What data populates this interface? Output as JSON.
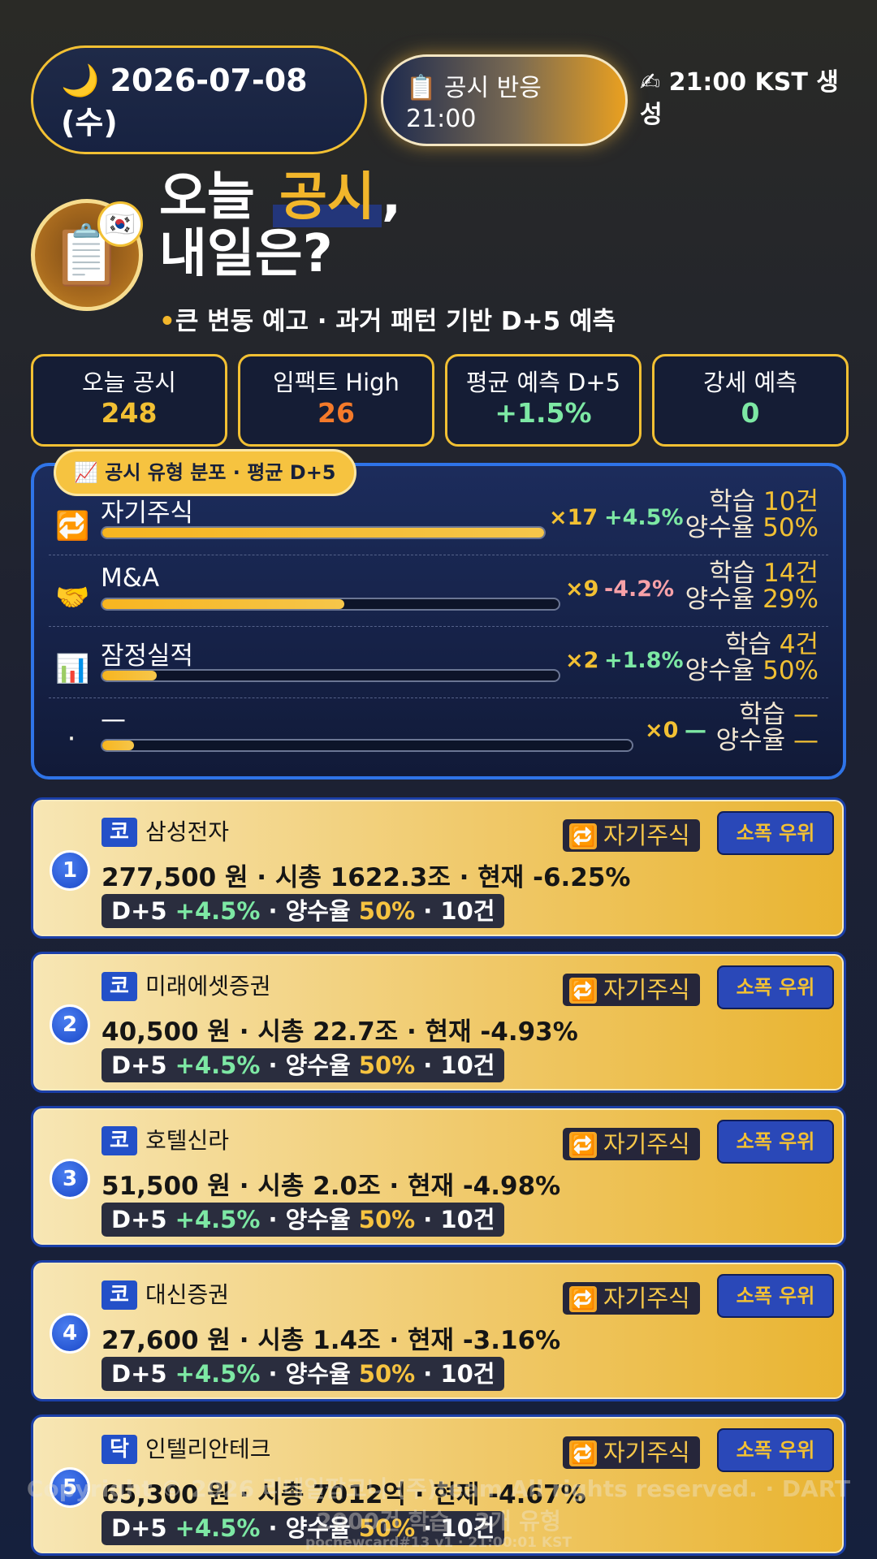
{
  "header": {
    "date": "🌙 2026-07-08 (수)",
    "event_line1": "📋 공시 반응",
    "event_line2": "21:00",
    "generated": "✍ 21:00 KST 생성"
  },
  "hero": {
    "icon": "📋",
    "flag": "🇰🇷",
    "title_a": "오늘 ",
    "title_highlight": "공시",
    "title_b": ",",
    "title_line2": "내일은?",
    "subtitle": "큰 변동 예고 · 과거 패턴 기반 D+5 예측"
  },
  "stats": [
    {
      "label": "오늘 공시",
      "value": "248",
      "color": "#f2c033"
    },
    {
      "label": "임팩트 High",
      "value": "26",
      "color": "#f47a2a"
    },
    {
      "label": "평균 예측 D+5",
      "value": "+1.5%",
      "color": "#7de8a4"
    },
    {
      "label": "강세 예측",
      "value": "0",
      "color": "#7de8a4"
    }
  ],
  "distribution": {
    "tag": "📈 공시 유형 분포 · 평균 D+5",
    "rows": [
      {
        "icon": "🔁",
        "name": "자기주식",
        "count": "×17",
        "pct": "+4.5%",
        "pct_color": "#7de8a4",
        "learn_label": "학습",
        "learn": "10건",
        "win_label": "양수율",
        "win": "50%",
        "fill": 1.0
      },
      {
        "icon": "🤝",
        "name": "M&A",
        "count": "×9",
        "pct": "-4.2%",
        "pct_color": "#f8a1a8",
        "learn_label": "학습",
        "learn": "14건",
        "win_label": "양수율",
        "win": "29%",
        "fill": 0.53
      },
      {
        "icon": "📊",
        "name": "잠정실적",
        "count": "×2",
        "pct": "+1.8%",
        "pct_color": "#7de8a4",
        "learn_label": "학습",
        "learn": "4건",
        "win_label": "양수율",
        "win": "50%",
        "fill": 0.12
      },
      {
        "icon": "·",
        "name": "—",
        "count": "×0",
        "pct": "—",
        "pct_color": "#7de8a4",
        "learn_label": "학습",
        "learn": "—",
        "win_label": "양수율",
        "win": "—",
        "fill": 0.06
      }
    ]
  },
  "stocks": [
    {
      "rank": "1",
      "market": "코",
      "name": "삼성전자",
      "type": "자기주식",
      "type_icon": "🔁",
      "priority": "소폭 우위",
      "price": "277,500 원",
      "cap": "시총 1622.3조",
      "change": "현재 -6.25%",
      "d5_label": "D+5",
      "d5": "+4.5%",
      "win_label": "양수율",
      "win": "50%",
      "samples": "10건"
    },
    {
      "rank": "2",
      "market": "코",
      "name": "미래에셋증권",
      "type": "자기주식",
      "type_icon": "🔁",
      "priority": "소폭 우위",
      "price": "40,500 원",
      "cap": "시총 22.7조",
      "change": "현재 -4.93%",
      "d5_label": "D+5",
      "d5": "+4.5%",
      "win_label": "양수율",
      "win": "50%",
      "samples": "10건"
    },
    {
      "rank": "3",
      "market": "코",
      "name": "호텔신라",
      "type": "자기주식",
      "type_icon": "🔁",
      "priority": "소폭 우위",
      "price": "51,500 원",
      "cap": "시총 2.0조",
      "change": "현재 -4.98%",
      "d5_label": "D+5",
      "d5": "+4.5%",
      "win_label": "양수율",
      "win": "50%",
      "samples": "10건"
    },
    {
      "rank": "4",
      "market": "코",
      "name": "대신증권",
      "type": "자기주식",
      "type_icon": "🔁",
      "priority": "소폭 우위",
      "price": "27,600 원",
      "cap": "시총 1.4조",
      "change": "현재 -3.16%",
      "d5_label": "D+5",
      "d5": "+4.5%",
      "win_label": "양수율",
      "win": "50%",
      "samples": "10건"
    },
    {
      "rank": "5",
      "market": "닥",
      "name": "인텔리안테크",
      "type": "자기주식",
      "type_icon": "🔁",
      "priority": "소폭 우위",
      "price": "65,300 원",
      "cap": "시총 7012억",
      "change": "현재 -4.67%",
      "d5_label": "D+5",
      "d5": "+4.5%",
      "win_label": "양수율",
      "win": "50%",
      "samples": "10건"
    }
  ],
  "footer": {
    "copyright": "Copyright © 2026 리테일팝코니 (주)team All rights reserved. · DART",
    "summary": "2000건 학습 · 3개 유형",
    "build": "pocnewcard#13 v1 · 21:00:01 KST"
  }
}
